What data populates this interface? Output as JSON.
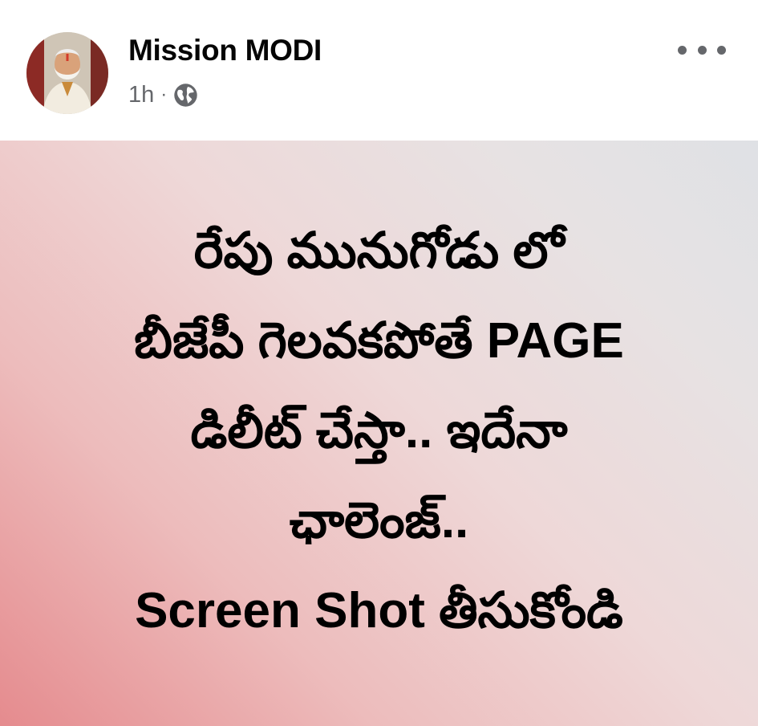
{
  "post": {
    "author": "Mission MODI",
    "time": "1h",
    "separator": "·",
    "privacy_icon": "globe-icon",
    "more_icon": "more-options-icon",
    "lines": [
      "రేపు మునుగోడు లో",
      "బీజేపీ గెలవకపోతే PAGE",
      "డిలీట్ చేస్తా.. ఇదేనా",
      "ఛాలెంజ్..",
      "Screen Shot తీసుకోండి"
    ]
  },
  "colors": {
    "author_text": "#050505",
    "meta_text": "#65676b",
    "gradient_start": "#e58b8e",
    "gradient_end": "#dfe1e5",
    "post_text": "#000000"
  }
}
